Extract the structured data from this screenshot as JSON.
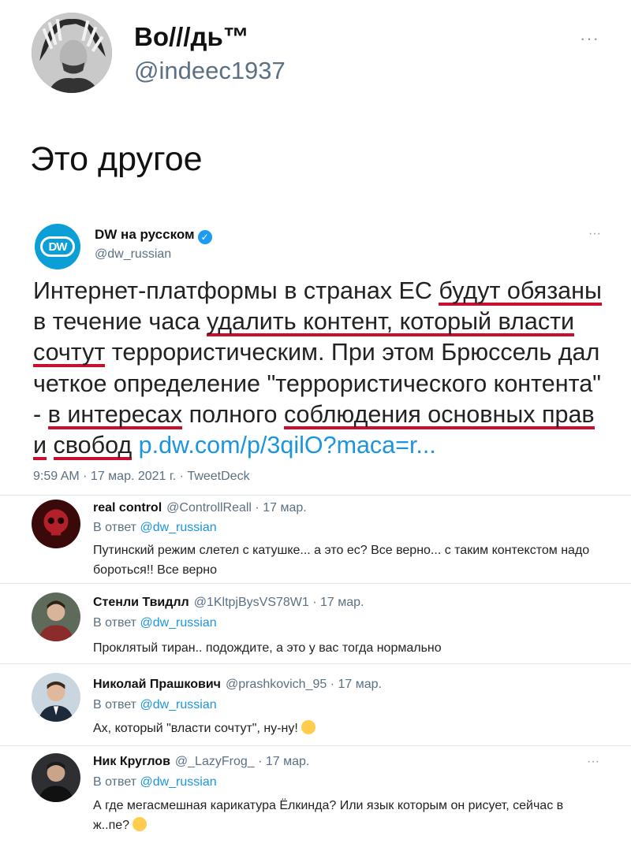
{
  "outer": {
    "name": "Во///дь™",
    "handle": "@indeec1937",
    "more": "···",
    "text": "Это другое"
  },
  "quote": {
    "name": "DW на русском",
    "logo": "DW",
    "handle": "@dw_russian",
    "more": "···",
    "text_parts": [
      "Интернет-платформы в странах ЕС ",
      "будут обязаны",
      " в течение часа ",
      "удалить контент, который власти",
      " ",
      "сочтут",
      " террористическим. При этом Брюссель дал четкое определение \"террористического контента\" - ",
      "в интересах",
      " полного ",
      "соблюдения основных прав и",
      " ",
      "свобод",
      " "
    ],
    "link": "p.dw.com/p/3qilO?maca=r...",
    "meta": "9:59 AM · 17 мар. 2021 г. · TweetDeck",
    "underline_color": "#c8102e",
    "link_color": "#1b95e0"
  },
  "replies": [
    {
      "name": "real control",
      "handle_date": "@ControllReall · 17 мар.",
      "reply_prefix": "В ответ ",
      "reply_to": "@dw_russian",
      "text": "Путинский режим слетел с катушке... а это ес? Все верно... с таким контекстом надо бороться!! Все верно"
    },
    {
      "name": "Стенли Твидлл",
      "handle_date": "@1KltpjBysVS78W1 · 17 мар.",
      "reply_prefix": "В ответ ",
      "reply_to": "@dw_russian",
      "text": "Проклятый тиран.. подождите, а это у вас тогда нормально"
    },
    {
      "name": "Николай Прашкович",
      "handle_date": "@prashkovich_95 · 17 мар.",
      "reply_prefix": "В ответ ",
      "reply_to": "@dw_russian",
      "text": "Ах, который \"власти сочтут\", ну-ну!"
    },
    {
      "name": "Ник Круглов",
      "handle_date": "@_LazyFrog_ · 17 мар.",
      "reply_prefix": "В ответ ",
      "reply_to": "@dw_russian",
      "text": "А где мегасмешная карикатура Ёлкинда? Или язык которым он рисует, сейчас в ж..пе?",
      "more": "···"
    }
  ]
}
